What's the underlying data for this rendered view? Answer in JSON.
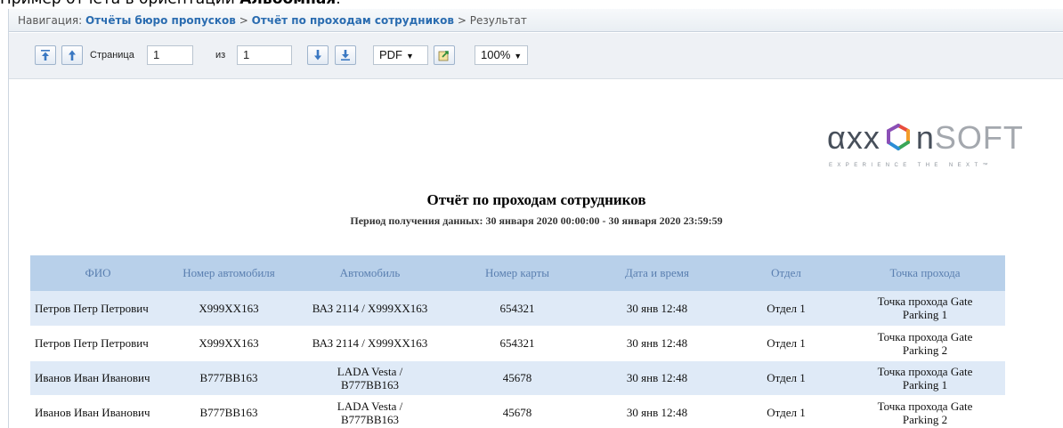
{
  "caption": {
    "prefix": "Пример отчёта в ориентации ",
    "bold": "Альбомная",
    "suffix": "."
  },
  "nav": {
    "label": "Навигация:",
    "crumb1": "Отчёты бюро пропусков",
    "sep1": ">",
    "crumb2": "Отчёт по проходам сотрудников",
    "sep2": ">",
    "current": "Результат"
  },
  "toolbar": {
    "first_icon": "first-page-icon",
    "prev_icon": "prev-page-icon",
    "page_label": "Страница",
    "page_value": "1",
    "of_label": "из",
    "of_value": "1",
    "next_icon": "next-page-icon",
    "last_icon": "last-page-icon",
    "format": "PDF",
    "export_icon": "export-icon",
    "zoom": "100%"
  },
  "logo": {
    "text_left": "αxx",
    "text_n": "n",
    "text_soft": "SOFT",
    "tagline": "EXPERIENCE THE NEXT™",
    "colors": [
      "#e94c3d",
      "#f39c2a",
      "#3aa657",
      "#2b8ed6",
      "#8b4fb6"
    ]
  },
  "report": {
    "title": "Отчёт по проходам сотрудников",
    "period": "Период получения данных: 30 января 2020 00:00:00 - 30 января 2020 23:59:59",
    "columns": [
      "ФИО",
      "Номер автомобиля",
      "Автомобиль",
      "Номер карты",
      "Дата и время",
      "Отдел",
      "Точка прохода"
    ],
    "rows": [
      {
        "fio": "Петров Петр Петрович",
        "plate": "Х999ХХ163",
        "car_line1": "ВАЗ 2114 / Х999ХХ163",
        "car_line2": "",
        "card": "654321",
        "datetime": "30 янв 12:48",
        "dept": "Отдел 1",
        "point_line1": "Точка прохода Gate",
        "point_line2": "Parking 1"
      },
      {
        "fio": "Петров Петр Петрович",
        "plate": "Х999ХХ163",
        "car_line1": "ВАЗ 2114 / Х999ХХ163",
        "car_line2": "",
        "card": "654321",
        "datetime": "30 янв 12:48",
        "dept": "Отдел 1",
        "point_line1": "Точка прохода Gate",
        "point_line2": "Parking 2"
      },
      {
        "fio": "Иванов Иван Иванович",
        "plate": "В777ВВ163",
        "car_line1": "LADA Vesta /",
        "car_line2": "В777ВВ163",
        "card": "45678",
        "datetime": "30 янв 12:48",
        "dept": "Отдел 1",
        "point_line1": "Точка прохода Gate",
        "point_line2": "Parking 1"
      },
      {
        "fio": "Иванов Иван Иванович",
        "plate": "В777ВВ163",
        "car_line1": "LADA Vesta /",
        "car_line2": "В777ВВ163",
        "card": "45678",
        "datetime": "30 янв 12:48",
        "dept": "Отдел 1",
        "point_line1": "Точка прохода Gate",
        "point_line2": "Parking 2"
      }
    ]
  }
}
